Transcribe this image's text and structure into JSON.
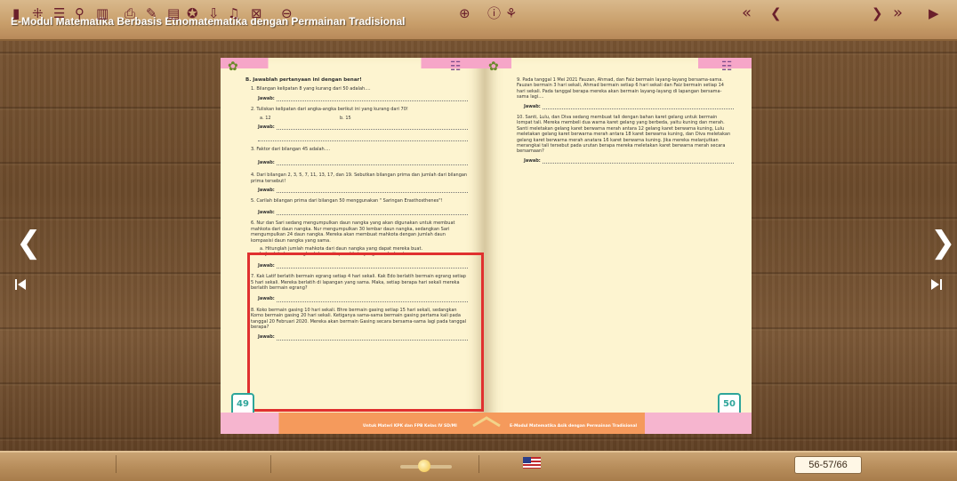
{
  "app": {
    "title": "E-Modul Matematika Berbasis Etnomatematika dengan Permainan Tradisional"
  },
  "navigation": {
    "prev_icon": "chevron-left-icon",
    "next_icon": "chevron-right-icon",
    "first_icon": "skip-first-icon",
    "last_icon": "skip-last-icon",
    "prev_glyph": "❮",
    "next_glyph": "❯",
    "first_glyph": "⏮",
    "last_glyph": "⏭"
  },
  "left_page": {
    "page_number": "49",
    "footer": "Untuk Materi KPK dan FPB Kelas IV SD/MI",
    "heading": "B. Jawablah pertanyaan ini dengan benar!",
    "answer_label": "Jawab:",
    "q1": "1. Bilangan kelipatan 8 yang kurang dari 50 adalah....",
    "q2": "2. Tuliskan kelipatan dari angka-angka berikut ini yang kurang dari 70!",
    "q2a": "a. 12",
    "q2b": "b. 15",
    "q3": "3. Faktor dari bilangan 45 adalah....",
    "q4": "4. Dari bilangan 2, 3, 5, 7, 11, 13, 17, dan 19. Sebutkan bilangan prima dan jumlah dari bilangan prima tersebut!",
    "q5": "5. Carilah bilangan prima dari bilangan 50 menggunakan \" Saringan Erasthosthenes\"!",
    "q6": "6. Nur dan Sari sedang mengumpulkan daun nangka yang akan digunakan untuk membuat mahkota dari daun nangka. Nur mengumpulkan 30 lembar daun nangka, sedangkan Sari mengumpulkan 24 daun nangka. Mereka akan membuat mahkota dengan jumlah daun kompasisi daun nangka yang sama.",
    "q6a": "a. Hitunglah jumlah mahkota dari daun nangka yang dapat mereka buat.",
    "q6b": "b. Jumlah daun nangka dalam setiap mahkota yang mereka buat.",
    "q7": "7. Kak Latif berlatih bermain egrang setiap 4 hari sekali. Kak Edo berlatih bermain egrang setiap 5 hari sekali. Mereka berlatih di lapangan yang sama. Maka, setiap berapa hari sekali mereka berlatih bermain egrang?",
    "q8": "8. Koko bermain gasing 10 hari sekali. Bhre bermain gasing setiap 15 hari sekali, sedangkan Komo bermain gasing 20 hari sekali. Ketiganya sama-sama bermain gasing pertama kali pada tanggal 20 Februari 2020. Mereka akan bermain Gasing secara bersama-sama lagi pada tanggal berapa?"
  },
  "right_page": {
    "page_number": "50",
    "footer": "E-Modul Matematika Asik dengan Permainan Tradisional",
    "answer_label": "Jawab:",
    "q9": "9. Pada tanggal 1 Mei 2021 Fauzan, Ahmad, dan Faiz bermain layang-layang bersama-sama. Fauzan bermain 3 hari sekali, Ahmad bermain setiap 6 hari sekali dan Faiz bermain setiap 14 hari sekali. Pada tanggal berapa mereka akan bermain layang-layang di lapangan bersama-sama lagi....",
    "q10": "10. Santi, Lulu, dan Diva sedang membuat tali dengan bahan karet gelang untuk bermain lompat tali. Mereka membeli dua warna karet gelang yang berbeda, yaitu kuning dan merah. Santi meletakan gelang karet berwarna merah antara 12 gelang karet berwarna kuning, Lulu meletakan gelang karet berwarna merah antara 18 karet berwarna kuning, dan Diva meletakan gelang karet berwarna merah anatara 16 karet berwarna kuning. Jika mereka melanjutkan merangkai tali tersebut pada urutan berapa mereka meletakan karet berwarna merah secara bersamaan?"
  },
  "toolbar": {
    "icons": [
      "book-icon",
      "thumbnails-icon",
      "table-of-contents-icon",
      "search-icon",
      "bookmarks-icon",
      "print-icon",
      "pen-icon",
      "notes-icon",
      "share-icon",
      "download-icon",
      "sound-icon",
      "fullscreen-icon",
      "zoom-out-icon",
      "zoom-in-icon",
      "info-icon",
      "autoflip-icon",
      "language-flag-icon"
    ],
    "page_indicator": "56-57/66",
    "first_glyph": "«",
    "prev_glyph": "❮",
    "next_glyph": "❯",
    "last_glyph": "»",
    "play_glyph": "▶"
  },
  "colors": {
    "highlight": "#e0302f",
    "page_number": "#2ea59a",
    "toolbar_icon": "#6a1f2b"
  }
}
